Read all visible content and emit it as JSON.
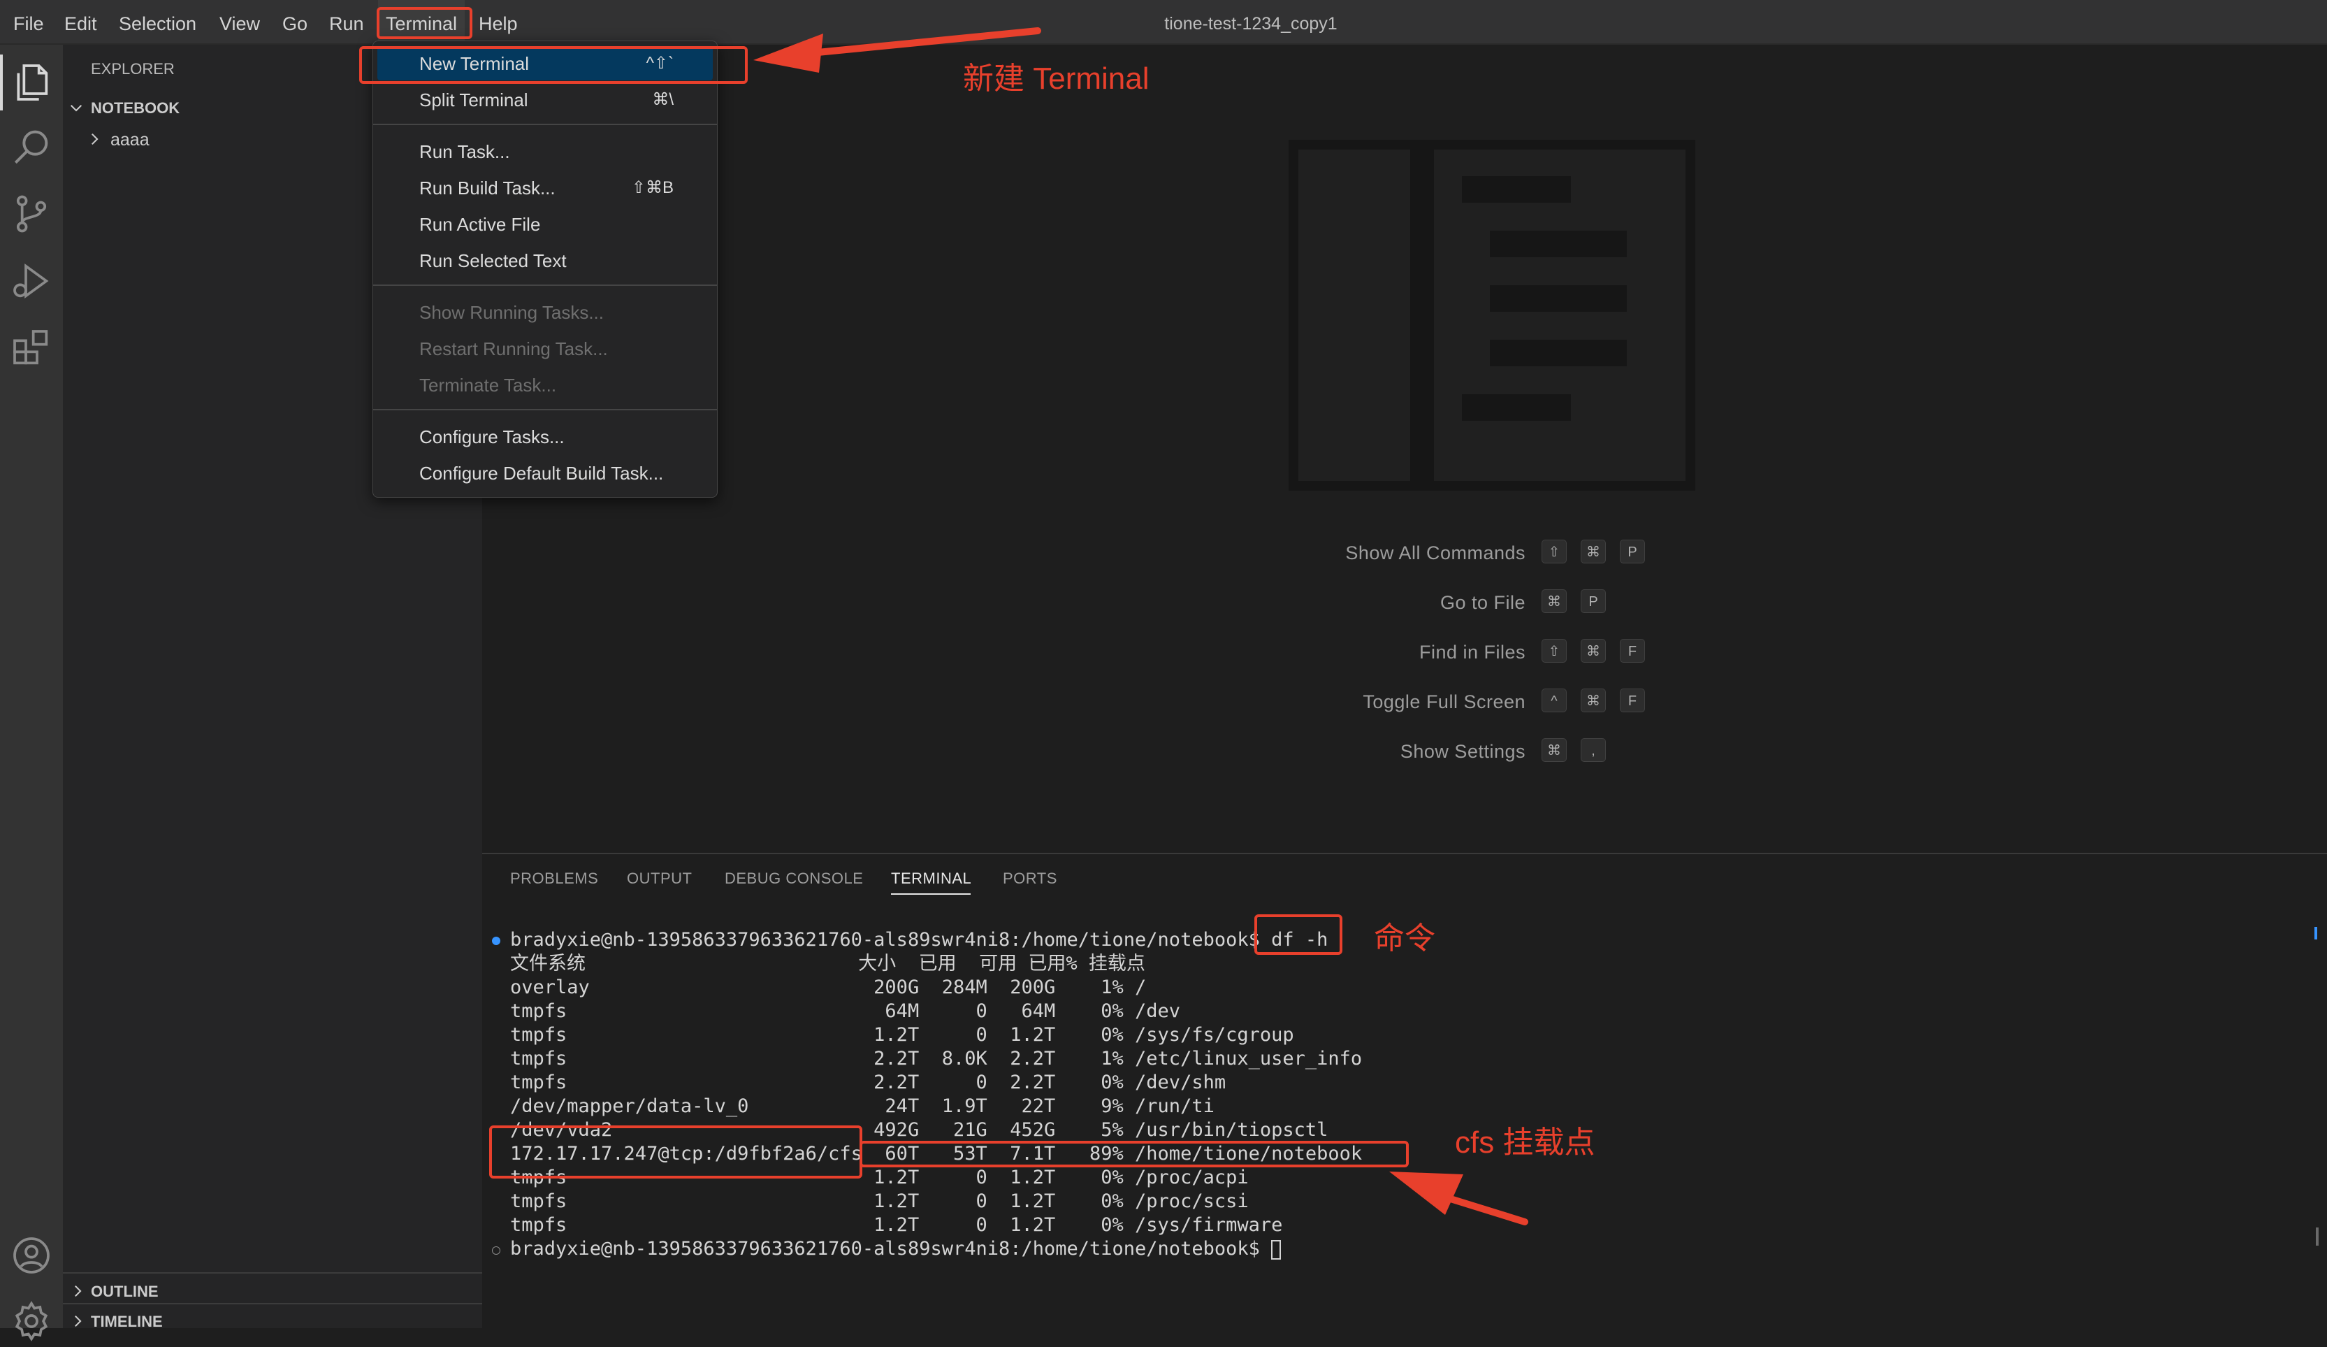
{
  "window": {
    "title": "tione-test-1234_copy1"
  },
  "menubar": {
    "items": [
      "File",
      "Edit",
      "Selection",
      "View",
      "Go",
      "Run",
      "Terminal",
      "Help"
    ],
    "open_menu": "Terminal"
  },
  "activity_bar": {
    "icons": [
      "explorer-icon",
      "search-icon",
      "source-control-icon",
      "run-debug-icon",
      "extensions-icon",
      "account-icon",
      "settings-gear-icon"
    ]
  },
  "sidebar": {
    "title": "EXPLORER",
    "section": "NOTEBOOK",
    "tree": [
      {
        "label": "aaaa",
        "expanded": false
      }
    ],
    "bottom_sections": [
      "OUTLINE",
      "TIMELINE"
    ]
  },
  "terminal_menu": {
    "items": [
      {
        "label": "New Terminal",
        "shortcut": "^⇧`",
        "selected": true,
        "disabled": false
      },
      {
        "label": "Split Terminal",
        "shortcut": "⌘\\",
        "disabled": false
      },
      {
        "label": "Run Task...",
        "shortcut": "",
        "disabled": false
      },
      {
        "label": "Run Build Task...",
        "shortcut": "⇧⌘B",
        "disabled": false
      },
      {
        "label": "Run Active File",
        "shortcut": "",
        "disabled": false
      },
      {
        "label": "Run Selected Text",
        "shortcut": "",
        "disabled": false
      },
      {
        "label": "Show Running Tasks...",
        "shortcut": "",
        "disabled": true
      },
      {
        "label": "Restart Running Task...",
        "shortcut": "",
        "disabled": true
      },
      {
        "label": "Terminate Task...",
        "shortcut": "",
        "disabled": true
      },
      {
        "label": "Configure Tasks...",
        "shortcut": "",
        "disabled": false
      },
      {
        "label": "Configure Default Build Task...",
        "shortcut": "",
        "disabled": false
      }
    ]
  },
  "editor": {
    "watermark": "vscode-letterpress-icon",
    "commands": [
      {
        "label": "Show All Commands",
        "keys": [
          "⇧",
          "⌘",
          "P"
        ]
      },
      {
        "label": "Go to File",
        "keys": [
          "⌘",
          "P"
        ]
      },
      {
        "label": "Find in Files",
        "keys": [
          "⇧",
          "⌘",
          "F"
        ]
      },
      {
        "label": "Toggle Full Screen",
        "keys": [
          "^",
          "⌘",
          "F"
        ]
      },
      {
        "label": "Show Settings",
        "keys": [
          "⌘",
          ","
        ]
      }
    ]
  },
  "panel": {
    "tabs": [
      "PROBLEMS",
      "OUTPUT",
      "DEBUG CONSOLE",
      "TERMINAL",
      "PORTS"
    ],
    "active_tab": "TERMINAL"
  },
  "terminal": {
    "prompt": "bradyxie@nb-1395863379633621760-als89swr4ni8:/home/tione/notebook$ ",
    "command": "df -h",
    "lines": [
      "文件系统                        大小  已用  可用 已用% 挂载点",
      "overlay                         200G  284M  200G    1% /",
      "tmpfs                            64M     0   64M    0% /dev",
      "tmpfs                           1.2T     0  1.2T    0% /sys/fs/cgroup",
      "tmpfs                           2.2T  8.0K  2.2T    1% /etc/linux_user_info",
      "tmpfs                           2.2T     0  2.2T    0% /dev/shm",
      "/dev/mapper/data-lv_0            24T  1.9T   22T    9% /run/ti",
      "/dev/vda2                       492G   21G  452G    5% /usr/bin/tiopsctl",
      "172.17.17.247@tcp:/d9fbf2a6/cfs  60T   53T  7.1T   89% /home/tione/notebook",
      "tmpfs                           1.2T     0  1.2T    0% /proc/acpi",
      "tmpfs                           1.2T     0  1.2T    0% /proc/scsi",
      "tmpfs                           1.2T     0  1.2T    0% /sys/firmware"
    ],
    "final_prompt": "bradyxie@nb-1395863379633621760-als89swr4ni8:/home/tione/notebook$ "
  },
  "annotations": {
    "new_terminal": "新建 Terminal",
    "command": "命令",
    "cfs_mount": "cfs 挂载点",
    "accent": "#e8402c"
  }
}
